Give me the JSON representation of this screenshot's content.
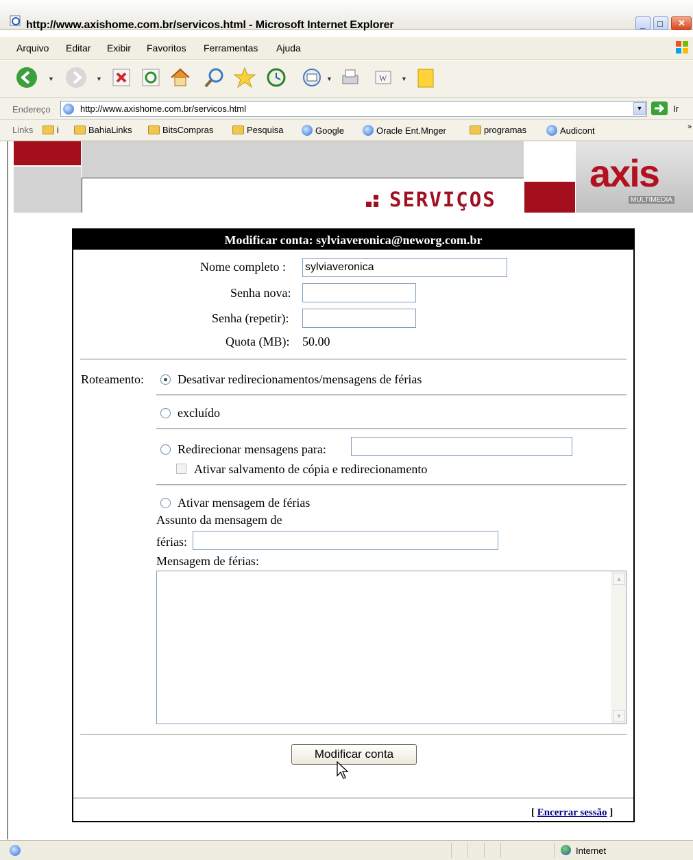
{
  "window": {
    "title": "http://www.axishome.com.br/servicos.html - Microsoft Internet Explorer"
  },
  "menu": [
    "Arquivo",
    "Editar",
    "Exibir",
    "Favoritos",
    "Ferramentas",
    "Ajuda"
  ],
  "address": {
    "label": "Endereço",
    "url": "http://www.axishome.com.br/servicos.html",
    "go_label": "Ir"
  },
  "links": {
    "label": "Links",
    "items": [
      "i",
      "BahiaLinks",
      "BitsCompras",
      "Pesquisa",
      "Google",
      "Oracle Ent.Mnger",
      "programas",
      "Audicont"
    ],
    "overflow": "»"
  },
  "banner": {
    "section": "SERVIÇOS",
    "logo": "axis",
    "logo_sub": "MULTIMEDIA"
  },
  "form": {
    "heading": "Modificar conta: sylviaveronica@neworg.com.br",
    "full_name_label": "Nome completo :",
    "full_name_value": "sylviaveronica",
    "new_password_label": "Senha nova:",
    "repeat_password_label": "Senha (repetir):",
    "quota_label": "Quota (MB):",
    "quota_value": "50.00",
    "routing_label": "Roteamento:",
    "routing_options": {
      "disable": "Desativar redirecionamentos/mensagens de férias",
      "deleted": "excluído",
      "forward": "Redirecionar mensagens para:",
      "vacation": "Ativar mensagem de férias"
    },
    "routing_selected": "disable",
    "keep_copy_label": "Ativar salvamento de cópia e redirecionamento",
    "vacation_subject_label_line1": "Assunto da mensagem de",
    "vacation_subject_label_line2": "férias:",
    "vacation_message_label": "Mensagem de férias:",
    "submit_label": "Modificar conta",
    "logout_open": "[",
    "logout_label": "Encerrar sessão",
    "logout_close": "]"
  },
  "status": {
    "zone": "Internet"
  }
}
